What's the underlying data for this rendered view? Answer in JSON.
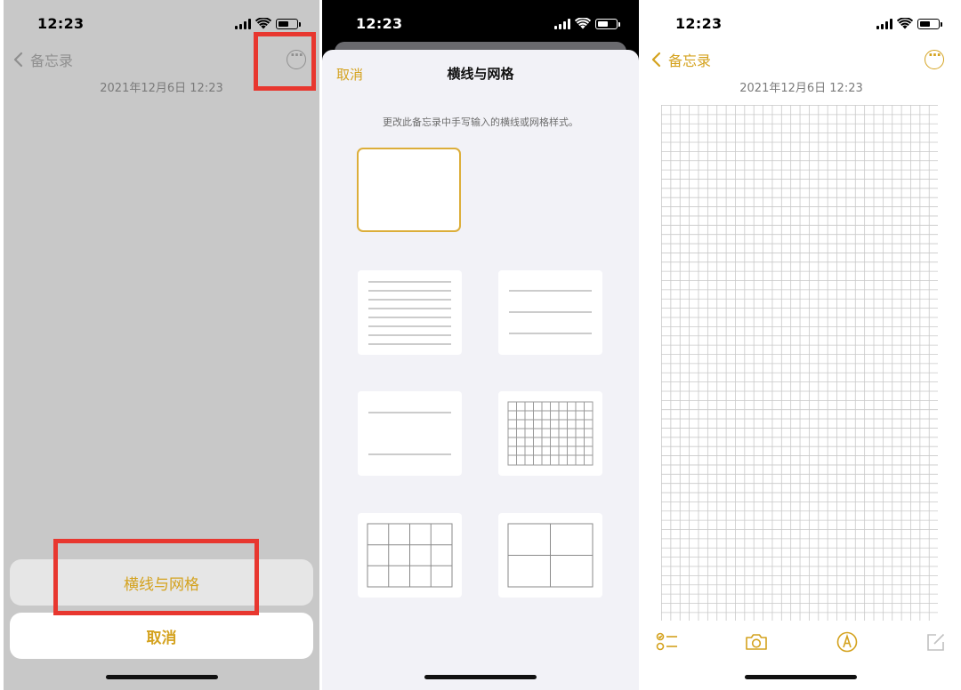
{
  "status_time": "12:23",
  "panel1": {
    "back_label": "备忘录",
    "date": "2021年12月6日 12:23",
    "sheet_option": "横线与网格",
    "sheet_cancel": "取消"
  },
  "panel2": {
    "cancel": "取消",
    "title": "横线与网格",
    "description": "更改此备忘录中手写输入的横线或网格样式。",
    "styles": [
      "blank",
      "narrow-lines",
      "medium-lines",
      "wide-lines",
      "small-grid",
      "medium-grid",
      "large-grid"
    ],
    "selected_style": "blank"
  },
  "panel3": {
    "back_label": "备忘录",
    "date": "2021年12月6日 12:23",
    "toolbar": [
      "checklist-icon",
      "camera-icon",
      "markup-icon",
      "compose-icon"
    ]
  },
  "colors": {
    "accent": "#d4a21e",
    "highlight": "#e8372f",
    "dim_background": "#c8c8c8",
    "sheet_background": "#f2f2f7",
    "grid_line": "#c9c9c9"
  }
}
